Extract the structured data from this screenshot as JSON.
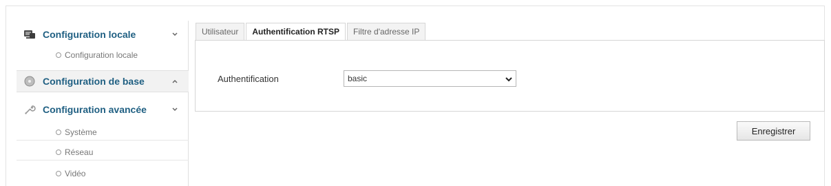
{
  "sidebar": {
    "local_config": {
      "label": "Configuration locale",
      "icon": "monitor-icon",
      "items": [
        {
          "label": "Configuration locale"
        }
      ]
    },
    "basic_config": {
      "label": "Configuration de base",
      "icon": "disc-icon"
    },
    "advanced_config": {
      "label": "Configuration avancée",
      "icon": "wrench-icon",
      "items": [
        {
          "label": "Système"
        },
        {
          "label": "Réseau"
        },
        {
          "label": "Vidéo"
        }
      ]
    }
  },
  "tabs": [
    {
      "label": "Utilisateur",
      "active": false
    },
    {
      "label": "Authentification RTSP",
      "active": true
    },
    {
      "label": "Filtre d'adresse IP",
      "active": false
    }
  ],
  "form": {
    "auth_label": "Authentification",
    "auth_value": "basic"
  },
  "save_label": "Enregistrer",
  "colors": {
    "sidebar_header_text": "#1f5f82",
    "border": "#d6d6d6"
  }
}
